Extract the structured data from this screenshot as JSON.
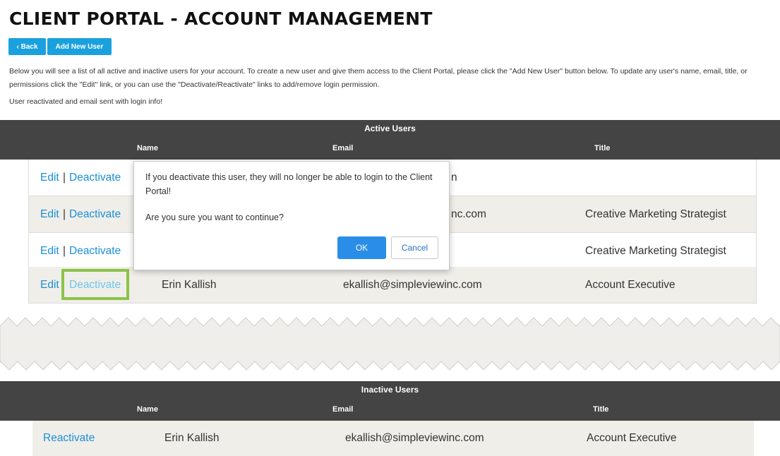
{
  "page": {
    "title": "CLIENT PORTAL - ACCOUNT MANAGEMENT"
  },
  "toolbar": {
    "back_label": "‹ Back",
    "add_user_label": "Add New User"
  },
  "intro_text": "Below you will see a list of all active and inactive users for your account. To create a new user and give them access to the Client Portal, please click the \"Add New User\" button below. To update any user's name, email, title, or permissions click the \"Edit\" link, or you can use the \"Deactivate/Reactivate\" links to add/remove login permission.",
  "status_message": "User reactivated and email sent with login info!",
  "active_users": {
    "title": "Active Users",
    "columns": {
      "name": "Name",
      "email": "Email",
      "title": "Title"
    },
    "edit_label": "Edit",
    "separator": "|",
    "deactivate_label": "Deactivate",
    "rows": [
      {
        "email_fragment": "n",
        "title": ""
      },
      {
        "email_fragment": "nc.com",
        "title": "Creative Marketing Strategist"
      },
      {
        "email_fragment": "",
        "title": "Creative Marketing Strategist"
      },
      {
        "name": "Erin Kallish",
        "email": "ekallish@simpleviewinc.com",
        "title": "Account Executive"
      }
    ]
  },
  "dialog": {
    "message": "If you deactivate this user, they will no longer be able to login to the Client Portal!",
    "question": "Are you sure you want to continue?",
    "ok_label": "OK",
    "cancel_label": "Cancel"
  },
  "inactive_users": {
    "title": "Inactive Users",
    "columns": {
      "name": "Name",
      "email": "Email",
      "title": "Title"
    },
    "reactivate_label": "Reactivate",
    "rows": [
      {
        "name": "Erin Kallish",
        "email": "ekallish@simpleviewinc.com",
        "title": "Account Executive"
      }
    ]
  },
  "colors": {
    "accent": "#1aa1dd",
    "link": "#1a8fd6",
    "header_bar": "#444444",
    "row_alt": "#f0eee9",
    "highlight": "#8bc34a",
    "ok_button": "#2a8ee8"
  }
}
